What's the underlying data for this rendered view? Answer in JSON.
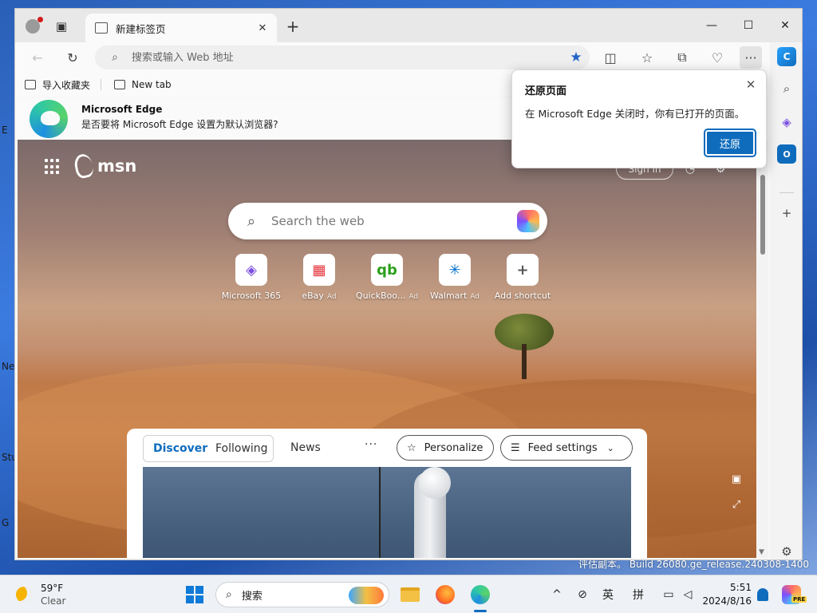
{
  "browser": {
    "tab": {
      "title": "新建标签页",
      "close_glyph": "✕"
    },
    "new_tab_glyph": "+",
    "window_controls": {
      "minimize": "—",
      "maximize": "☐",
      "close": "✕"
    },
    "toolbar": {
      "back_glyph": "←",
      "refresh_glyph": "↻",
      "address_placeholder": "搜索或输入 Web 地址",
      "favorite_glyph": "★",
      "more_glyph": "···"
    },
    "favorites_bar": [
      {
        "label": "导入收藏夹"
      },
      {
        "label": "New tab"
      }
    ],
    "infobar": {
      "title": "Microsoft Edge",
      "message": "是否要将 Microsoft Edge 设置为默认浏览器?"
    },
    "restore_popup": {
      "title": "还原页面",
      "message": "在 Microsoft Edge 关闭时，你有已打开的页面。",
      "button": "还原",
      "close_glyph": "✕"
    }
  },
  "msn": {
    "logo_text": "msn",
    "signin_label": "Sign in",
    "search_placeholder": "Search the web",
    "shortcuts": [
      {
        "label": "Microsoft 365",
        "ad": "",
        "glyph": "◈",
        "color": "#7b4fe0"
      },
      {
        "label": "eBay",
        "ad": "Ad",
        "glyph": "▦",
        "color": "#e53238"
      },
      {
        "label": "QuickBoo...",
        "ad": "Ad",
        "glyph": "qb",
        "color": "#2ca01c"
      },
      {
        "label": "Walmart",
        "ad": "Ad",
        "glyph": "✳",
        "color": "#0071ce"
      },
      {
        "label": "Add shortcut",
        "ad": "",
        "glyph": "+",
        "color": "#555555"
      }
    ],
    "feed": {
      "tabs": [
        "Discover",
        "Following"
      ],
      "news_label": "News",
      "more_glyph": "···",
      "personalize_label": "Personalize",
      "feed_settings_label": "Feed settings"
    }
  },
  "desktop": {
    "watermark": "评估副本。 Build 26080.ge_release.240308-1400",
    "left_fragments": [
      "E",
      "Ne",
      "Stu",
      "G"
    ]
  },
  "taskbar": {
    "weather": {
      "temp": "59°F",
      "condition": "Clear"
    },
    "search_label": "搜索",
    "tray": {
      "ime_lang": "英",
      "ime_mode": "拼",
      "chevron": "^"
    },
    "clock": {
      "time": "5:51",
      "date": "2024/8/16"
    },
    "pre_badge": "PRE"
  },
  "colors": {
    "accent": "#0f6cbd",
    "favorite_star": "#1f63c6"
  }
}
